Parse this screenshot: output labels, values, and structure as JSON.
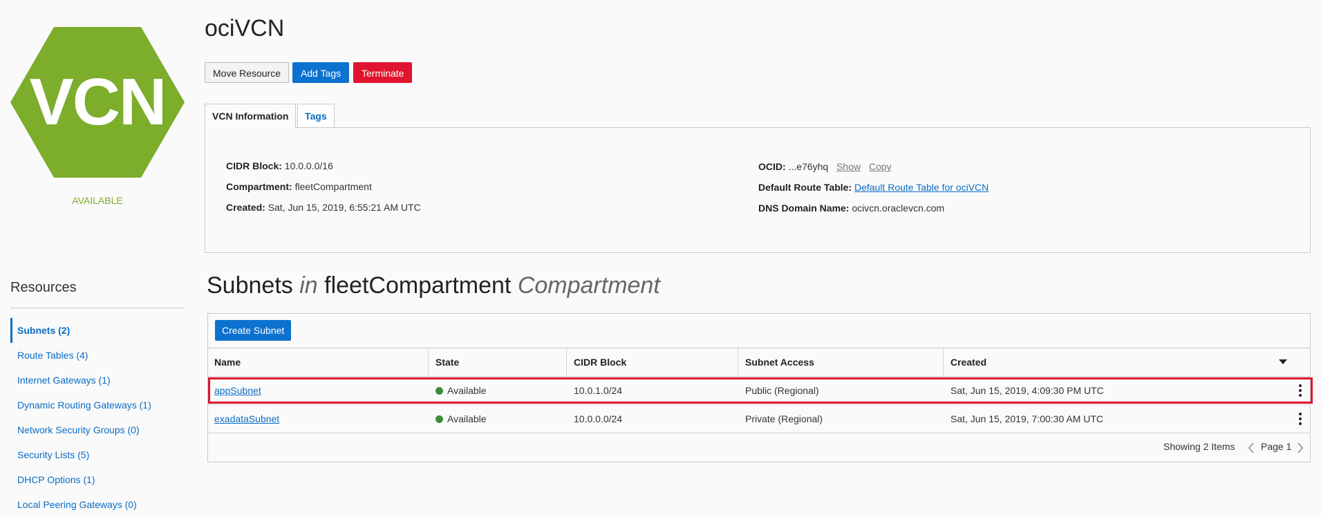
{
  "resource": {
    "logo_text": "VCN",
    "status": "AVAILABLE",
    "title": "ociVCN"
  },
  "actions": {
    "move_label": "Move Resource",
    "tags_label": "Add Tags",
    "terminate_label": "Terminate"
  },
  "tabs": [
    {
      "label": "VCN Information"
    },
    {
      "label": "Tags"
    }
  ],
  "info": {
    "cidr_label": "CIDR Block:",
    "cidr_value": "10.0.0.0/16",
    "compartment_label": "Compartment:",
    "compartment_value": "fleetCompartment",
    "created_label": "Created:",
    "created_value": "Sat, Jun 15, 2019, 6:55:21 AM UTC",
    "ocid_label": "OCID:",
    "ocid_value": "...e76yhq",
    "ocid_show": "Show",
    "ocid_copy": "Copy",
    "route_label": "Default Route Table:",
    "route_value": "Default Route Table for ociVCN",
    "dns_label": "DNS Domain Name:",
    "dns_value": "ocivcn.oraclevcn.com"
  },
  "sidebar": {
    "title": "Resources",
    "items": [
      {
        "label": "Subnets (2)"
      },
      {
        "label": "Route Tables (4)"
      },
      {
        "label": "Internet Gateways (1)"
      },
      {
        "label": "Dynamic Routing Gateways (1)"
      },
      {
        "label": "Network Security Groups (0)"
      },
      {
        "label": "Security Lists (5)"
      },
      {
        "label": "DHCP Options (1)"
      },
      {
        "label": "Local Peering Gateways (0)"
      }
    ]
  },
  "subnets": {
    "heading_a": "Subnets",
    "heading_in": "in",
    "heading_comp": "fleetCompartment",
    "heading_suffix": "Compartment",
    "create_label": "Create Subnet",
    "columns": [
      "Name",
      "State",
      "CIDR Block",
      "Subnet Access",
      "Created"
    ],
    "rows": [
      {
        "name": "appSubnet",
        "state": "Available",
        "cidr": "10.0.1.0/24",
        "access": "Public (Regional)",
        "created": "Sat, Jun 15, 2019, 4:09:30 PM UTC"
      },
      {
        "name": "exadataSubnet",
        "state": "Available",
        "cidr": "10.0.0.0/24",
        "access": "Private (Regional)",
        "created": "Sat, Jun 15, 2019, 7:00:30 AM UTC"
      }
    ],
    "showing": "Showing 2 Items",
    "page": "Page 1"
  },
  "colors": {
    "accent": "#0b72cf",
    "danger": "#e0142e",
    "logo_green": "#7cad2b",
    "state_green": "#3b8c3b"
  }
}
